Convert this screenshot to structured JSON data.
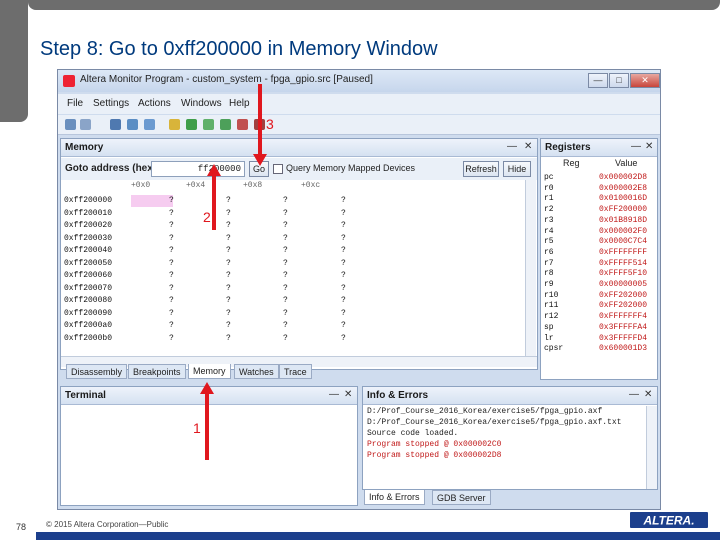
{
  "slide": {
    "title": "Step 8: Go to 0xff200000 in Memory Window",
    "page_number": "78",
    "copyright": "© 2015 Altera Corporation—Public",
    "logo_text": "ALTERA."
  },
  "window": {
    "title": "Altera Monitor Program - custom_system - fpga_gpio.src [Paused]",
    "controls": [
      "—",
      "□",
      "✕"
    ]
  },
  "menu": [
    "File",
    "Settings",
    "Actions",
    "Windows",
    "Help"
  ],
  "memory": {
    "title": "Memory",
    "goto_label": "Goto address (hex):",
    "address_value": "ff200000",
    "go_label": "Go",
    "query_label": "Query Memory Mapped Devices",
    "refresh_label": "Refresh",
    "hide_label": "Hide",
    "columns": [
      "+0x0",
      "+0x4",
      "+0x8",
      "+0xc"
    ],
    "rows": [
      {
        "addr": "0xff200000",
        "cells": [
          "?",
          "?",
          "?",
          "?"
        ]
      },
      {
        "addr": "0xff200010",
        "cells": [
          "?",
          "?",
          "?",
          "?"
        ]
      },
      {
        "addr": "0xff200020",
        "cells": [
          "?",
          "?",
          "?",
          "?"
        ]
      },
      {
        "addr": "0xff200030",
        "cells": [
          "?",
          "?",
          "?",
          "?"
        ]
      },
      {
        "addr": "0xff200040",
        "cells": [
          "?",
          "?",
          "?",
          "?"
        ]
      },
      {
        "addr": "0xff200050",
        "cells": [
          "?",
          "?",
          "?",
          "?"
        ]
      },
      {
        "addr": "0xff200060",
        "cells": [
          "?",
          "?",
          "?",
          "?"
        ]
      },
      {
        "addr": "0xff200070",
        "cells": [
          "?",
          "?",
          "?",
          "?"
        ]
      },
      {
        "addr": "0xff200080",
        "cells": [
          "?",
          "?",
          "?",
          "?"
        ]
      },
      {
        "addr": "0xff200090",
        "cells": [
          "?",
          "?",
          "?",
          "?"
        ]
      },
      {
        "addr": "0xff2000a0",
        "cells": [
          "?",
          "?",
          "?",
          "?"
        ]
      },
      {
        "addr": "0xff2000b0",
        "cells": [
          "?",
          "?",
          "?",
          "?"
        ]
      }
    ]
  },
  "tabs_main": [
    "Disassembly",
    "Breakpoints",
    "Memory",
    "Watches",
    "Trace"
  ],
  "registers": {
    "title": "Registers",
    "col_reg": "Reg",
    "col_value": "Value",
    "rows": [
      {
        "reg": "pc",
        "value": "0x000002D8"
      },
      {
        "reg": "r0",
        "value": "0x000002E8"
      },
      {
        "reg": "r1",
        "value": "0x0100016D"
      },
      {
        "reg": "r2",
        "value": "0xFF200000"
      },
      {
        "reg": "r3",
        "value": "0x01B8918D"
      },
      {
        "reg": "r4",
        "value": "0x000002F0"
      },
      {
        "reg": "r5",
        "value": "0x0000C7C4"
      },
      {
        "reg": "r6",
        "value": "0xFFFFFFFF"
      },
      {
        "reg": "r7",
        "value": "0xFFFFF514"
      },
      {
        "reg": "r8",
        "value": "0xFFFF5F10"
      },
      {
        "reg": "r9",
        "value": "0x00000005"
      },
      {
        "reg": "r10",
        "value": "0xFF202000"
      },
      {
        "reg": "r11",
        "value": "0xFF202000"
      },
      {
        "reg": "r12",
        "value": "0xFFFFFFF4"
      },
      {
        "reg": "sp",
        "value": "0x3FFFFFA4"
      },
      {
        "reg": "lr",
        "value": "0x3FFFFFD4"
      },
      {
        "reg": "cpsr",
        "value": "0x600001D3"
      }
    ]
  },
  "terminal": {
    "title": "Terminal"
  },
  "info": {
    "title": "Info & Errors",
    "lines": [
      {
        "text": "D:/Prof_Course_2016_Korea/exercise5/fpga_gpio.axf",
        "kind": "normal"
      },
      {
        "text": "D:/Prof_Course_2016_Korea/exercise5/fpga_gpio.axf.txt",
        "kind": "normal"
      },
      {
        "text": "Source code loaded.",
        "kind": "normal"
      },
      {
        "text": "Program stopped @ 0x000002C0",
        "kind": "error"
      },
      {
        "text": "Program stopped @ 0x000002D8",
        "kind": "error"
      }
    ],
    "tabs": [
      "Info & Errors",
      "GDB Server"
    ]
  },
  "annotations": [
    "1",
    "2",
    "3"
  ],
  "colors": {
    "title": "#003a7d",
    "arrow": "#e0171e",
    "register_value": "#c01818",
    "highlight": "#f6ccf0"
  }
}
